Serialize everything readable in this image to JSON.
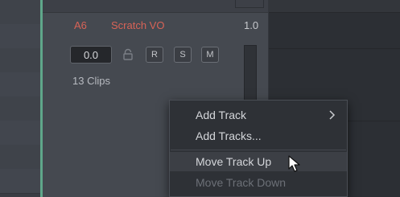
{
  "track": {
    "id": "A6",
    "name": "Scratch VO",
    "volume_label": "1.0",
    "level_value": "0.0",
    "buttons": {
      "record": "R",
      "solo": "S",
      "mute": "M"
    },
    "clips_text": "13 Clips"
  },
  "context_menu": {
    "items": [
      {
        "label": "Add Track",
        "has_submenu": true,
        "enabled": true
      },
      {
        "label": "Add Tracks...",
        "has_submenu": false,
        "enabled": true
      },
      {
        "label": "Move Track Up",
        "has_submenu": false,
        "enabled": true,
        "hovered": true
      },
      {
        "label": "Move Track Down",
        "has_submenu": false,
        "enabled": false
      }
    ]
  },
  "colors": {
    "track_name": "#d86357",
    "accent_line": "#5fa78a",
    "menu_bg": "#2e3136"
  },
  "icons": [
    "lock-icon",
    "chevron-right-icon",
    "mouse-pointer-icon"
  ]
}
